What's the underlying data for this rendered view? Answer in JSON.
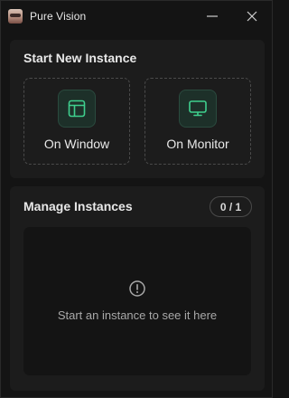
{
  "window": {
    "title": "Pure Vision",
    "app_icon": "pure-vision-logo",
    "controls": {
      "minimize_icon": "minimize-icon",
      "close_icon": "close-icon"
    }
  },
  "start_section": {
    "title": "Start New Instance",
    "options": [
      {
        "label": "On Window",
        "icon": "window-layout-icon"
      },
      {
        "label": "On Monitor",
        "icon": "monitor-icon"
      }
    ]
  },
  "manage_section": {
    "title": "Manage Instances",
    "count": "0 / 1",
    "empty_icon": "alert-circle-icon",
    "empty_text": "Start an instance to see it here"
  },
  "colors": {
    "background": "#141414",
    "panel": "#1c1c1c",
    "accent_green": "#3fcf8e",
    "icon_tile": "#1d3029"
  }
}
